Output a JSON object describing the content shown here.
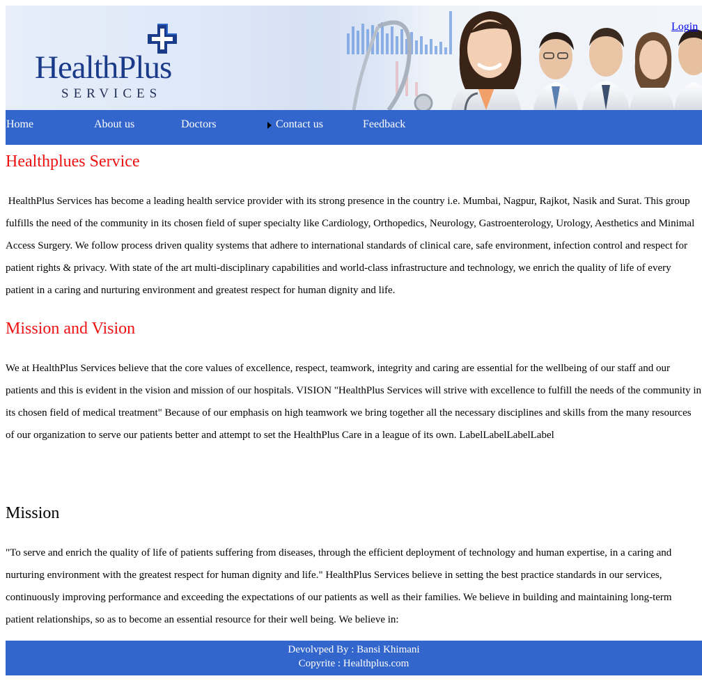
{
  "header": {
    "logo_word": "HealthPlus",
    "logo_sub": "SERVICES",
    "login": "Login"
  },
  "nav": {
    "items": [
      {
        "label": "Home"
      },
      {
        "label": "About us"
      },
      {
        "label": "Doctors"
      },
      {
        "label": "Contact us"
      },
      {
        "label": "Feedback"
      }
    ]
  },
  "sections": {
    "service_title": "Healthplues Service",
    "service_text": " HealthPlus Services has become a leading health service provider with its strong presence in the country i.e. Mumbai, Nagpur, Rajkot, Nasik and Surat. This group fulfills the need of the community in its chosen field of super specialty like Cardiology, Orthopedics, Neurology, Gastroenterology, Urology, Aesthetics and Minimal Access Surgery. We follow process driven quality systems that adhere to international standards of clinical care, safe environment, infection control and respect for patient rights & privacy. With state of the art multi-disciplinary capabilities and world-class infrastructure and technology, we enrich the quality of life of every patient in a caring and nurturing environment and greatest respect for human dignity and life.",
    "mv_title": "Mission and Vision",
    "mv_text": "We at HealthPlus Services believe that the core values of excellence, respect, teamwork, integrity and caring are essential for the wellbeing of our staff and our patients and this is evident in the vision and mission of our hospitals. VISION \"HealthPlus Services will strive with excellence to fulfill the needs of the community in its chosen field of medical treatment\" Because of our emphasis on high teamwork we bring together all the necessary disciplines and skills from the many resources of our organization to serve our patients better and attempt to set the HealthPlus Care in a league of its own. LabelLabelLabelLabel",
    "mission_title": "Mission",
    "mission_text": "\"To serve and enrich the quality of life of patients suffering from diseases, through the efficient deployment of technology and human expertise, in a caring and nurturing environment with the greatest respect for human dignity and life.\" HealthPlus Services believe in setting the best practice standards in our services, continuously improving performance and exceeding the expectations of our patients as well as their families. We believe in building and maintaining long-term patient relationships, so as to become an essential resource for their well being. We believe in:"
  },
  "footer": {
    "developed_by": "Devolvped By : Bansi Khimani",
    "copyright": "Copyrite : Healthplus.com"
  },
  "colors": {
    "nav_bg": "#3366cc",
    "heading_red": "#ee1111",
    "logo_blue": "#1a3b8a",
    "link": "#0000ee"
  }
}
